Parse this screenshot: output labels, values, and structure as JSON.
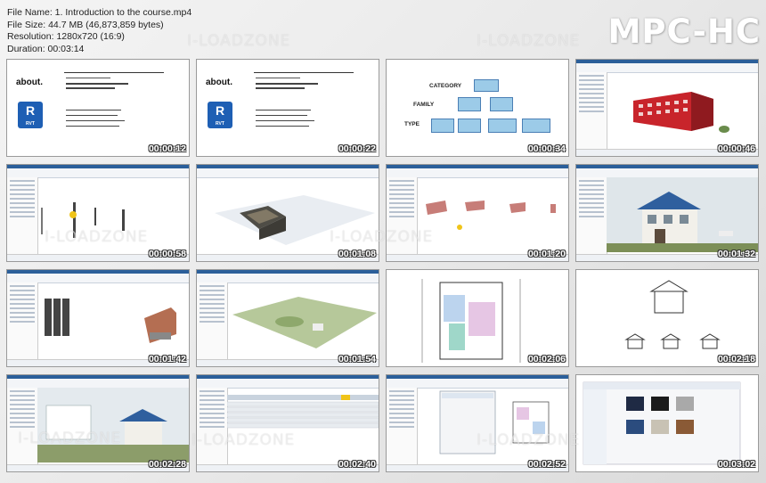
{
  "file_info": {
    "name": "File Name: 1. Introduction to the course.mp4",
    "size": "File Size: 44.7 MB (46,873,859 bytes)",
    "resolution": "Resolution: 1280x720 (16:9)",
    "duration": "Duration: 00:03:14"
  },
  "player_logo": "MPC-HC",
  "watermark": "I-LOADZONE",
  "slide": {
    "title": "about.",
    "logo_main": "R",
    "logo_sub": "RVT"
  },
  "diagram": {
    "category": "CATEGORY",
    "family": "FAMILY",
    "type": "TYPE"
  },
  "timestamps": [
    "00:00:12",
    "00:00:22",
    "00:00:34",
    "00:00:46",
    "00:00:58",
    "00:01:08",
    "00:01:20",
    "00:01:32",
    "00:01:42",
    "00:01:54",
    "00:02:06",
    "00:02:18",
    "00:02:28",
    "00:02:40",
    "00:02:52",
    "00:03:02"
  ],
  "colors": {
    "revit_blue": "#1e5fb4",
    "building_red": "#c8242b",
    "roof_blue": "#2f5f9e",
    "diagram_box": "#9ccbe8"
  }
}
